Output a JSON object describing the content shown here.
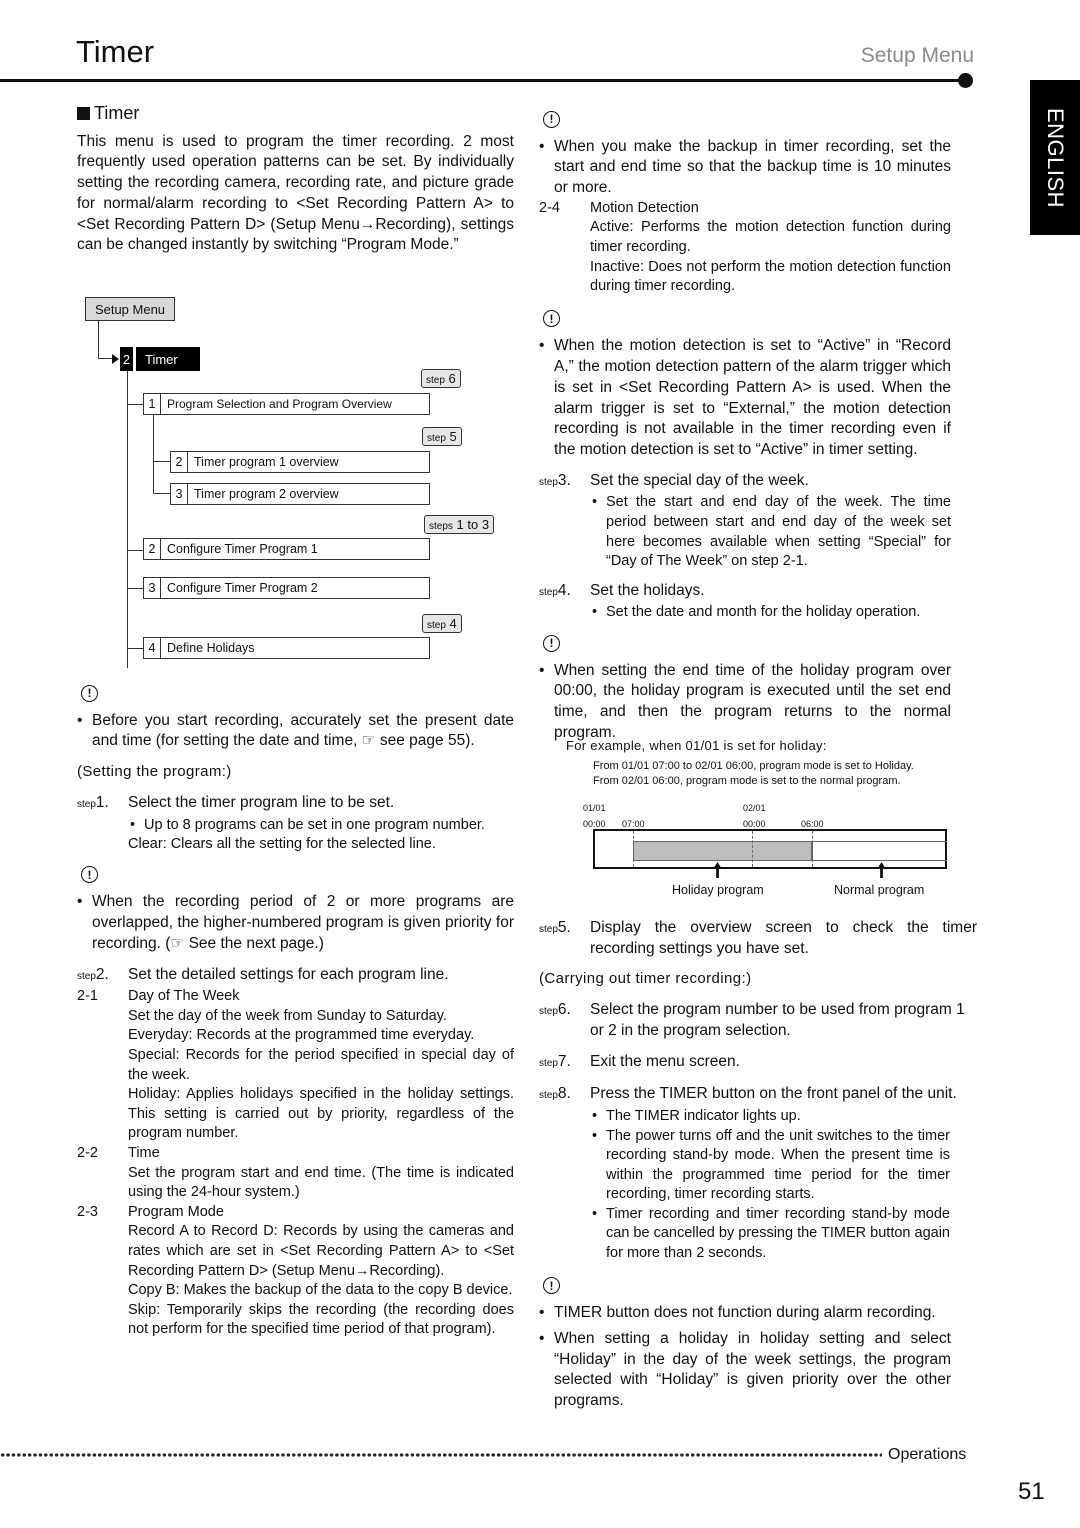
{
  "header": {
    "title": "Timer",
    "section": "Setup Menu",
    "language_tab": "ENGLISH"
  },
  "intro": {
    "heading": "Timer",
    "body": "This menu is used to program the timer recording. 2 most frequently used operation patterns can be set. By individually setting the recording camera, recording rate, and picture grade for normal/alarm recording to <Set Recording Pattern A> to <Set Recording Pattern D> (Setup Menu→Recording), settings can be changed instantly by switching “Program Mode.”"
  },
  "menu_tree": {
    "root": "Setup Menu",
    "selected": {
      "num": "2",
      "label": "Timer"
    },
    "items": [
      {
        "num": "1",
        "label": "Program Selection and Program Overview",
        "callout_prefix": "step",
        "callout_value": "6"
      },
      {
        "num": "2",
        "label": "Timer program 1 overview",
        "callout_prefix": "step",
        "callout_value": "5"
      },
      {
        "num": "3",
        "label": "Timer program 2 overview"
      },
      {
        "num": "2",
        "label": "Configure Timer Program 1",
        "callout_prefix": "steps",
        "callout_value": "1 to 3"
      },
      {
        "num": "3",
        "label": "Configure Timer Program 2"
      },
      {
        "num": "4",
        "label": "Define Holidays",
        "callout_prefix": "step",
        "callout_value": "4"
      }
    ]
  },
  "left": {
    "note1": "Before you start recording, accurately set the present date and time (for setting the date and time, ☞ see page 55).",
    "setting_heading": "(Setting the program:)",
    "step1": {
      "label": "step",
      "num": "1.",
      "text": "Select the timer program line to be set.",
      "bullet": "Up to 8 programs can be set in one program number.",
      "extra": "Clear: Clears all the setting for the selected line."
    },
    "note2": "When the recording period of 2 or more programs are overlapped, the higher-numbered program is given priority for recording. (☞ See the next page.)",
    "step2": {
      "label": "step",
      "num": "2.",
      "text": "Set the detailed settings for each program line."
    },
    "sub21": {
      "num": "2-1",
      "title": "Day of The Week",
      "lines": [
        "Set the day of the week from Sunday to Saturday.",
        "Everyday: Records at the programmed time everyday.",
        "Special: Records for the period specified in special day of the week.",
        "Holiday: Applies holidays specified in the holiday settings. This setting is carried out by priority, regardless of the program number."
      ]
    },
    "sub22": {
      "num": "2-2",
      "title": "Time",
      "lines": [
        "Set the program start and end time. (The time is indicated using the 24-hour system.)"
      ]
    },
    "sub23": {
      "num": "2-3",
      "title": "Program Mode",
      "lines": [
        "Record A to Record D: Records by using the cameras and rates which are set in <Set Recording Pattern A> to <Set Recording Pattern D> (Setup Menu→Recording).",
        "Copy B: Makes the backup of the data to the copy B device.",
        "Skip: Temporarily skips the recording (the recording does not perform for the specified time period of that program)."
      ]
    }
  },
  "right": {
    "note1": "When you make the backup in timer recording, set the start and end time so that the backup time is 10 minutes or more.",
    "sub24": {
      "num": "2-4",
      "title": "Motion Detection",
      "lines": [
        "Active: Performs the motion detection function during timer recording.",
        "Inactive: Does not perform the motion detection function during timer recording."
      ]
    },
    "note2": "When the motion detection is set to “Active” in “Record A,” the motion detection pattern of the alarm trigger which is set in <Set Recording Pattern A> is used. When the alarm trigger is set to “External,” the motion detection recording is not available in the timer recording even if the motion detection is set to “Active” in timer setting.",
    "step3": {
      "label": "step",
      "num": "3.",
      "text": "Set the special day of the week.",
      "bullet": "Set the start and end day of the week. The time period between start and end day of the week set here becomes available when setting “Special” for “Day of The Week” on step 2-1."
    },
    "step4": {
      "label": "step",
      "num": "4.",
      "text": "Set the holidays.",
      "bullet": "Set the date and month for the holiday operation."
    },
    "note3": "When setting the end time of the holiday program over 00:00, the holiday program is executed until the set end time, and then the program returns to the normal program.",
    "example": {
      "heading": "For example, when 01/01 is set for holiday:",
      "line1": "From 01/01 07:00 to 02/01 06:00, program mode is set to Holiday.",
      "line2": "From 02/01 06:00, program mode is set to the normal program.",
      "date1": "01/01",
      "date2": "02/01",
      "t0": "00:00",
      "t1": "07:00",
      "t2": "00:00",
      "t3": "06:00",
      "holiday_label": "Holiday program",
      "normal_label": "Normal program"
    },
    "step5": {
      "label": "step",
      "num": "5.",
      "text": "Display the overview screen to check the timer recording settings you have set."
    },
    "carrying_heading": "(Carrying out timer recording:)",
    "step6": {
      "label": "step",
      "num": "6.",
      "text": "Select the program number to be used from program 1 or 2 in the program selection."
    },
    "step7": {
      "label": "step",
      "num": "7.",
      "text": "Exit the menu screen."
    },
    "step8": {
      "label": "step",
      "num": "8.",
      "text": "Press the TIMER button on the front panel of the unit.",
      "bullets": [
        "The TIMER indicator lights up.",
        "The power turns off and the unit switches to the timer recording stand-by mode. When the present time is within the programmed time period for the timer recording, timer recording starts.",
        "Timer recording and timer recording stand-by mode can be cancelled by pressing the TIMER button again for more than 2 seconds."
      ]
    },
    "note4a": "TIMER button does not function during alarm recording.",
    "note4b": "When setting a holiday in holiday setting and select “Holiday” in the day of the week settings, the program selected with “Holiday” is given priority over the other programs."
  },
  "footer": {
    "section": "Operations",
    "page": "51"
  }
}
